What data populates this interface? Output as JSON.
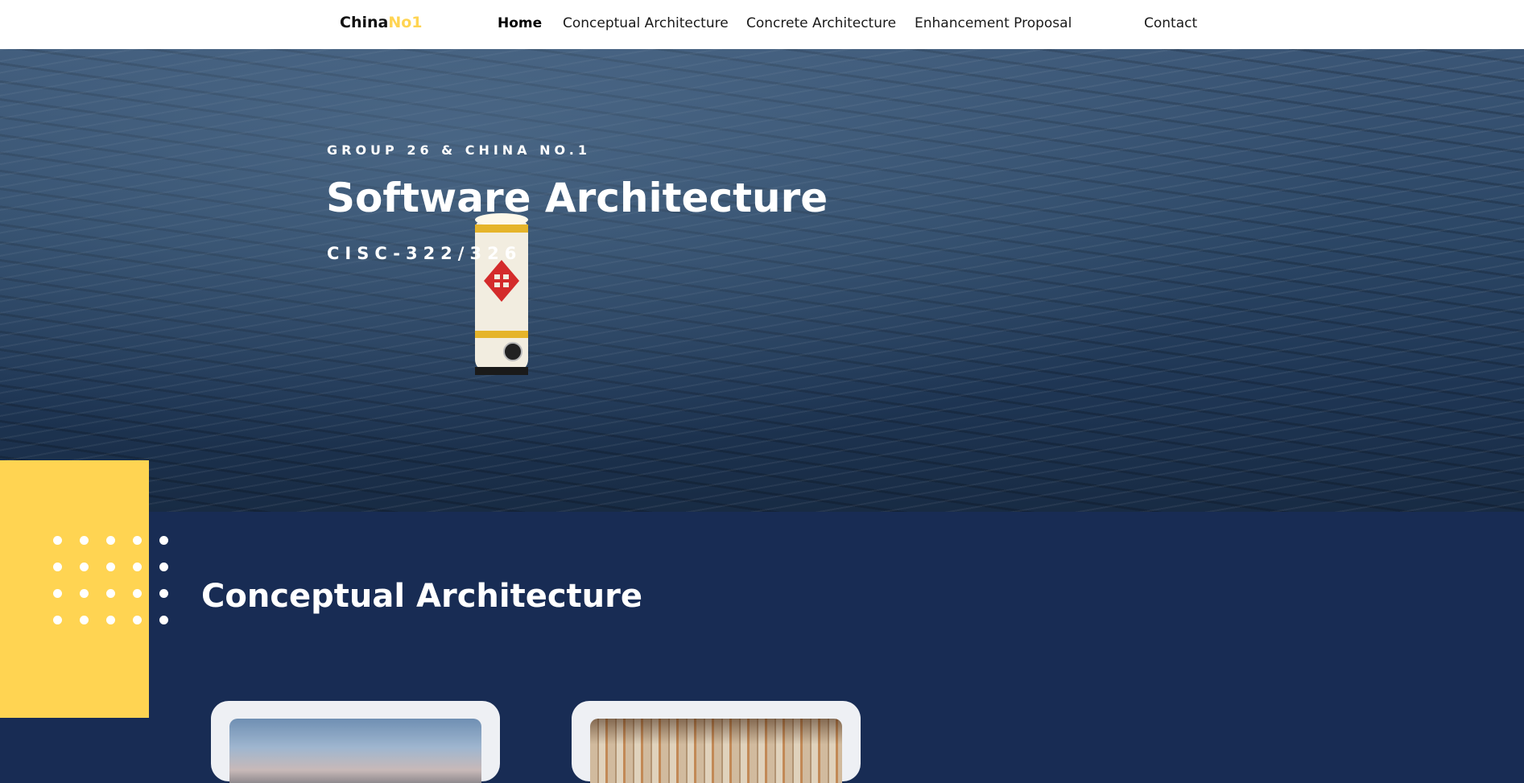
{
  "navbar": {
    "logo_main": "China",
    "logo_accent": "No1",
    "links": [
      "Home",
      "Conceptual Architecture",
      "Concrete Architecture",
      "Enhancement Proposal",
      "Contact"
    ]
  },
  "hero": {
    "eyebrow": "GROUP 26 & CHINA NO.1",
    "title": "Software Architecture",
    "subtitle": "CISC-322/326"
  },
  "section": {
    "title": "Conceptual Architecture"
  },
  "colors": {
    "accent": "#ffd452",
    "navy": "#182c54",
    "white": "#ffffff"
  }
}
